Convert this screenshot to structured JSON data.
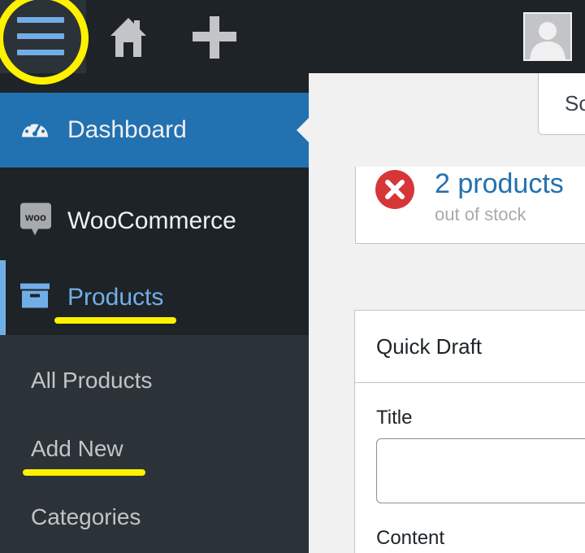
{
  "topbar": {
    "menu_icon": "hamburger-menu-icon",
    "home_icon": "home-icon",
    "new_icon": "plus-icon",
    "avatar_icon": "user-avatar-icon"
  },
  "sidebar": {
    "items": [
      {
        "label": "Dashboard",
        "icon": "dashboard-gauge-icon"
      },
      {
        "label": "WooCommerce",
        "icon": "woocommerce-icon"
      },
      {
        "label": "Products",
        "icon": "archive-box-icon"
      }
    ],
    "submenu": [
      {
        "label": "All Products"
      },
      {
        "label": "Add New"
      },
      {
        "label": "Categories"
      }
    ]
  },
  "main": {
    "screen_options_label": "Sc",
    "stock_status": {
      "count_text": "2 products",
      "sub_text": "out of stock",
      "icon": "error-x-icon"
    },
    "quick_draft": {
      "title": "Quick Draft",
      "title_label": "Title",
      "title_value": "",
      "content_label": "Content"
    }
  },
  "colors": {
    "admin_bar": "#1d2327",
    "accent": "#2271b1",
    "active_text": "#72aee6",
    "highlight": "#fff200",
    "error": "#d63638"
  }
}
